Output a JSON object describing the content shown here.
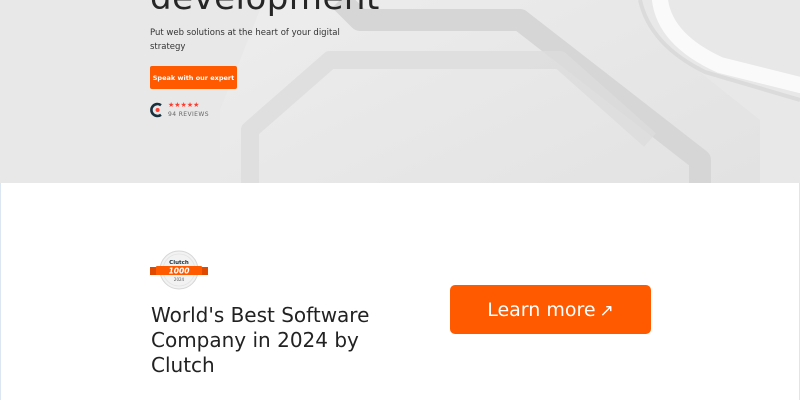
{
  "hero": {
    "title": "development",
    "subtitle": "Put web solutions at the heart of your digital strategy",
    "cta_label": "Speak with our expert",
    "rating": {
      "stars": "★★★★★",
      "reviews_label": "94 REVIEWS",
      "logo_icon": "clutch-logo-icon"
    }
  },
  "award": {
    "badge": {
      "brand": "Clutch",
      "rank": "1000",
      "year": "2024"
    },
    "heading": "World's Best Software Company in 2024 by Clutch",
    "cta_label": "Learn more",
    "cta_arrow": "↗"
  },
  "colors": {
    "accent": "#ff5a00",
    "star": "#ff3d2e",
    "hero_bg": "#e9e9e9",
    "text": "#222222"
  }
}
